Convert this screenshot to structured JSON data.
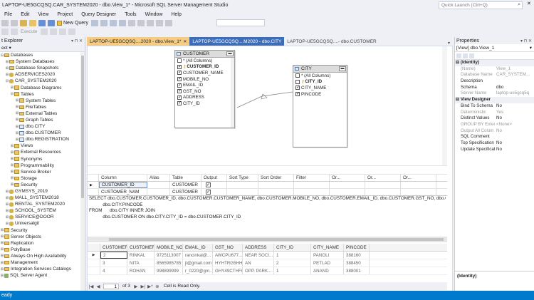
{
  "window": {
    "title": "LAPTOP-UE5GCQSQ.CAR_SYSTEM2020 - dbo.View_1* - Microsoft SQL Server Management Studio",
    "quick_launch_placeholder": "Quick Launch (Ctrl+Q)",
    "controls": [
      "—",
      "□",
      "✕"
    ]
  },
  "menu": [
    "File",
    "Edit",
    "View",
    "Project",
    "Query Designer",
    "Tools",
    "Window",
    "Help"
  ],
  "toolbar": {
    "new_query": "New Query",
    "execute": "Execute"
  },
  "object_explorer": {
    "title": "t Explorer",
    "connect": "ect ▾",
    "items": [
      {
        "label": "Databases",
        "indent": 0,
        "exp": "⊟",
        "icon": "folder"
      },
      {
        "label": "System Databases",
        "indent": 1,
        "exp": "⊞",
        "icon": "folder"
      },
      {
        "label": "Database Snapshots",
        "indent": 1,
        "exp": "⊞",
        "icon": "folder"
      },
      {
        "label": "ADSERVICES2020",
        "indent": 1,
        "exp": "⊞",
        "icon": "db"
      },
      {
        "label": "CAR_SYSTEM2020",
        "indent": 1,
        "exp": "⊟",
        "icon": "db"
      },
      {
        "label": "Database Diagrams",
        "indent": 2,
        "exp": "⊞",
        "icon": "folder"
      },
      {
        "label": "Tables",
        "indent": 2,
        "exp": "⊟",
        "icon": "folder"
      },
      {
        "label": "System Tables",
        "indent": 3,
        "exp": "⊞",
        "icon": "folder"
      },
      {
        "label": "FileTables",
        "indent": 3,
        "exp": "⊞",
        "icon": "folder"
      },
      {
        "label": "External Tables",
        "indent": 3,
        "exp": "⊞",
        "icon": "folder"
      },
      {
        "label": "Graph Tables",
        "indent": 3,
        "exp": "⊞",
        "icon": "folder"
      },
      {
        "label": "dbo.CITY",
        "indent": 3,
        "exp": "⊞",
        "icon": "table"
      },
      {
        "label": "dbo.CUSTOMER",
        "indent": 3,
        "exp": "⊞",
        "icon": "table"
      },
      {
        "label": "dbo.REGISTRATION",
        "indent": 3,
        "exp": "⊞",
        "icon": "table"
      },
      {
        "label": "Views",
        "indent": 2,
        "exp": "⊞",
        "icon": "folder"
      },
      {
        "label": "External Resources",
        "indent": 2,
        "exp": "⊞",
        "icon": "folder"
      },
      {
        "label": "Synonyms",
        "indent": 2,
        "exp": "⊞",
        "icon": "folder"
      },
      {
        "label": "Programmability",
        "indent": 2,
        "exp": "⊞",
        "icon": "folder"
      },
      {
        "label": "Service Broker",
        "indent": 2,
        "exp": "⊞",
        "icon": "folder"
      },
      {
        "label": "Storage",
        "indent": 2,
        "exp": "⊞",
        "icon": "folder"
      },
      {
        "label": "Security",
        "indent": 2,
        "exp": "⊞",
        "icon": "folder"
      },
      {
        "label": "GYMSYS_2019",
        "indent": 1,
        "exp": "⊞",
        "icon": "db"
      },
      {
        "label": "MALL_SYSTEM2018",
        "indent": 1,
        "exp": "⊞",
        "icon": "db"
      },
      {
        "label": "RENTAL_SYSTEM2020",
        "indent": 1,
        "exp": "⊞",
        "icon": "db"
      },
      {
        "label": "SCHOOL_SYSTEM",
        "indent": 1,
        "exp": "⊞",
        "icon": "db"
      },
      {
        "label": "SERVICE@DOOR",
        "indent": 1,
        "exp": "⊞",
        "icon": "db"
      },
      {
        "label": "Universalgit",
        "indent": 1,
        "exp": "⊞",
        "icon": "db"
      },
      {
        "label": "Security",
        "indent": 0,
        "exp": "⊞",
        "icon": "folder"
      },
      {
        "label": "Server Objects",
        "indent": 0,
        "exp": "⊞",
        "icon": "folder"
      },
      {
        "label": "Replication",
        "indent": 0,
        "exp": "⊞",
        "icon": "folder"
      },
      {
        "label": "PolyBase",
        "indent": 0,
        "exp": "⊞",
        "icon": "folder"
      },
      {
        "label": "Always On High Availability",
        "indent": 0,
        "exp": "⊞",
        "icon": "folder"
      },
      {
        "label": "Management",
        "indent": 0,
        "exp": "⊞",
        "icon": "folder"
      },
      {
        "label": "Integration Services Catalogs",
        "indent": 0,
        "exp": "⊞",
        "icon": "folder"
      },
      {
        "label": "SQL Server Agent",
        "indent": 0,
        "exp": "⊞",
        "icon": "server"
      }
    ]
  },
  "tabs": [
    {
      "label": "LAPTOP-UE5GCQSQ....2020 - dbo.View_1*",
      "state": "active",
      "close": "✕"
    },
    {
      "label": "LAPTOP-UE5GCQSQ....M2020 - dbo.CITY",
      "state": "hover",
      "close": ""
    },
    {
      "label": "LAPTOP-UE5GCQSQ....- dbo.CUSTOMER",
      "state": "normal",
      "close": ""
    }
  ],
  "diagram": {
    "customer": {
      "title": "CUSTOMER",
      "columns": [
        {
          "name": "* (All Columns)",
          "checked": false,
          "bold": false,
          "key": false
        },
        {
          "name": "CUSTOMER_ID",
          "checked": true,
          "bold": true,
          "key": true
        },
        {
          "name": "CUSTOMER_NAME",
          "checked": true,
          "bold": false,
          "key": false
        },
        {
          "name": "MOBILE_NO",
          "checked": true,
          "bold": false,
          "key": false
        },
        {
          "name": "EMAIL_ID",
          "checked": true,
          "bold": false,
          "key": false
        },
        {
          "name": "GST_NO",
          "checked": true,
          "bold": false,
          "key": false
        },
        {
          "name": "ADDRESS",
          "checked": true,
          "bold": false,
          "key": false
        },
        {
          "name": "CITY_ID",
          "checked": true,
          "bold": false,
          "key": false
        }
      ]
    },
    "city": {
      "title": "CITY",
      "columns": [
        {
          "name": "* (All Columns)",
          "checked": false,
          "bold": false,
          "key": false
        },
        {
          "name": "CITY_ID",
          "checked": false,
          "bold": true,
          "key": true
        },
        {
          "name": "CITY_NAME",
          "checked": true,
          "bold": false,
          "key": false
        },
        {
          "name": "PINCODE",
          "checked": true,
          "bold": false,
          "key": false
        }
      ]
    }
  },
  "criteria": {
    "headers": [
      "Column",
      "Alias",
      "Table",
      "Output",
      "Sort Type",
      "Sort Order",
      "Filter",
      "Or...",
      "Or...",
      "Or..."
    ],
    "rows": [
      {
        "column": "CUSTOMER_ID",
        "table": "CUSTOMER",
        "output": true
      },
      {
        "column": "CUSTOMER_NAM",
        "table": "CUSTOMER",
        "output": true
      }
    ]
  },
  "sql": [
    "SELECT dbo.CUSTOMER.CUSTOMER_ID, dbo.CUSTOMER.CUSTOMER_NAME, dbo.CUSTOMER.MOBILE_NO, dbo.CUSTOMER.EMAIL_ID, dbo.CUSTOMER.GST_NO, dbo.CUSTOMER.ADDRESS, dbo.CITY.CITY_NAME,",
    "           dbo.CITY.PINCODE",
    "FROM      dbo.CITY INNER JOIN",
    "           dbo.CUSTOMER ON dbo.CITY.CITY_ID = dbo.CUSTOMER.CITY_ID"
  ],
  "results": {
    "headers": [
      "CUSTOMER...",
      "CUSTOMER...",
      "MOBILE_NO",
      "EMAIL_ID",
      "GST_NO",
      "ADDRESS",
      "CITY_ID",
      "CITY_NAME",
      "PINCODE"
    ],
    "rows": [
      {
        "indicator": "▶",
        "cells": [
          "2",
          "RINKAL",
          "9725113007",
          "rancinkal@...",
          "AWCPU677...",
          "NEAR SOCI...",
          "1",
          "PANOLI",
          "388160"
        ]
      },
      {
        "indicator": "",
        "cells": [
          "3",
          "NITA",
          "8565985785",
          "jl@gmail.com",
          "HYHTRG5HH...",
          "AN",
          "2",
          "PETLAD",
          "388450"
        ]
      },
      {
        "indicator": "",
        "cells": [
          "4",
          "ROHAN",
          "998899999",
          "r_0220@gm...",
          "GHY49CTHFG",
          "OPP. PARK...",
          "1",
          "ANAND",
          "388001"
        ]
      }
    ]
  },
  "navbar": {
    "first": "|◀",
    "prev": "◀",
    "page": "1",
    "of": "of 3",
    "next": "▶",
    "last": "▶|",
    "new": "▶*",
    "delete": "⊗",
    "status": "Cell is Read Only."
  },
  "properties": {
    "title": "Properties",
    "object": "[View] dbo.View_1",
    "rows": [
      {
        "name": "(Identity)",
        "value": "",
        "cat": true,
        "dim": false
      },
      {
        "name": "(Name)",
        "value": "View_1",
        "cat": false,
        "dim": true
      },
      {
        "name": "Database Name",
        "value": "CAR_SYSTEM...",
        "cat": false,
        "dim": true
      },
      {
        "name": "Description",
        "value": "",
        "cat": false,
        "dim": false
      },
      {
        "name": "Schema",
        "value": "dbo",
        "cat": false,
        "dim": false
      },
      {
        "name": "Server Name",
        "value": "laptop-ue5gcq5q",
        "cat": false,
        "dim": true
      },
      {
        "name": "View Designer",
        "value": "",
        "cat": true,
        "dim": false
      },
      {
        "name": "Bind To Schema",
        "value": "No",
        "cat": false,
        "dim": false
      },
      {
        "name": "Deterministic",
        "value": "Yes",
        "cat": false,
        "dim": true
      },
      {
        "name": "Distinct Values",
        "value": "No",
        "cat": false,
        "dim": false
      },
      {
        "name": "GROUP BY Extensio",
        "value": "<None>",
        "cat": false,
        "dim": true
      },
      {
        "name": "Output All Colum",
        "value": "No",
        "cat": false,
        "dim": true
      },
      {
        "name": "SQL Comment",
        "value": "",
        "cat": false,
        "dim": false
      },
      {
        "name": "Top Specification",
        "value": "No",
        "cat": false,
        "dim": false
      },
      {
        "name": "Update Specificati",
        "value": "No",
        "cat": false,
        "dim": false
      }
    ],
    "desc": "(Identity)"
  },
  "status": "eady"
}
